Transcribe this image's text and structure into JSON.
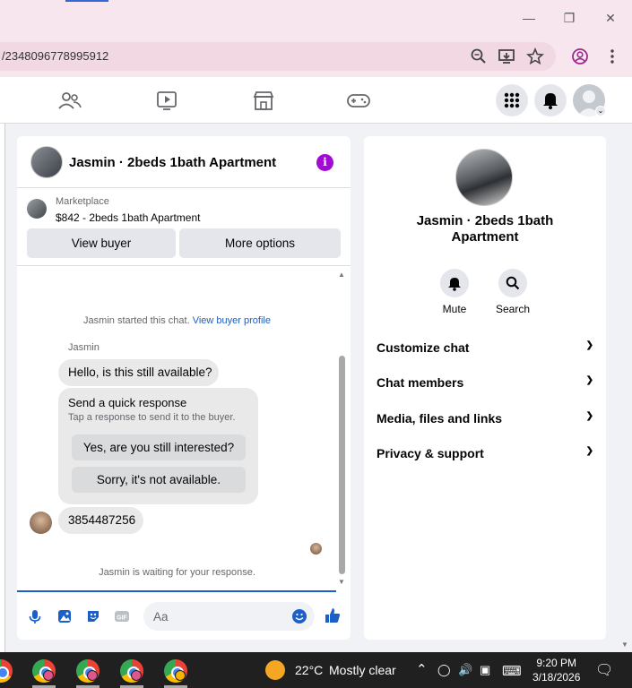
{
  "browser": {
    "url": "/2348096778995912",
    "window_controls": [
      "minimize",
      "restore",
      "close"
    ]
  },
  "chat": {
    "title": "Jasmin · 2beds 1bath Apartment",
    "marketplace_label": "Marketplace",
    "listing": "$842 - 2beds 1bath Apartment",
    "buttons": {
      "view_buyer": "View buyer",
      "more_options": "More options"
    },
    "started_text": "Jasmin started this chat.",
    "view_profile_link": "View buyer profile",
    "sender": "Jasmin",
    "message1": "Hello, is this still available?",
    "quick_response": {
      "title": "Send a quick response",
      "subtitle": "Tap a response to send it to the buyer.",
      "options": [
        "Yes, are you still interested?",
        "Sorry, it's not available."
      ]
    },
    "message2": "3854487256",
    "waiting_text": "Jasmin is waiting for your response.",
    "composer_placeholder": "Aa"
  },
  "info_panel": {
    "title": "Jasmin · 2beds 1bath Apartment",
    "actions": [
      {
        "label": "Mute",
        "icon": "bell-icon"
      },
      {
        "label": "Search",
        "icon": "search-icon"
      }
    ],
    "sections": [
      "Customize chat",
      "Chat members",
      "Media, files and links",
      "Privacy & support"
    ]
  },
  "taskbar": {
    "temperature": "22°C",
    "weather": "Mostly clear",
    "time": "9:20 PM",
    "date": "3/18/2026"
  },
  "colors": {
    "accent": "#1b5fc7",
    "info_icon": "#a30ad6",
    "browser_bg": "#f8e6ee"
  }
}
